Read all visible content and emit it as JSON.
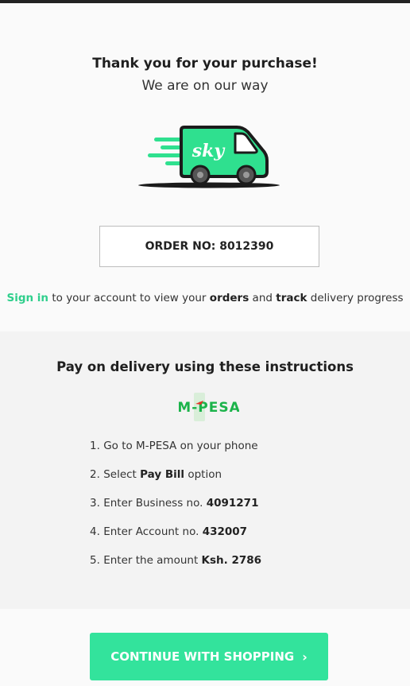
{
  "header": {
    "thank_you": "Thank you for your purchase!",
    "subtitle": "We are on our way"
  },
  "logo": {
    "text": "sky",
    "icon": "delivery-van-icon",
    "brand_color": "#2fe08f"
  },
  "order": {
    "label": "ORDER NO:",
    "number": "8012390"
  },
  "signin_line": {
    "link": "Sign in",
    "part1": "to your account to view your",
    "bold1": "orders",
    "part2": "and",
    "bold2": "track",
    "part3": "delivery progress"
  },
  "payment": {
    "title": "Pay on delivery using these instructions",
    "provider_logo": "M-PESA",
    "steps": [
      {
        "num": "1.",
        "text": "Go to M-PESA on your phone",
        "bold": ""
      },
      {
        "num": "2.",
        "text": "Select",
        "bold": "Pay Bill",
        "after": "option"
      },
      {
        "num": "3.",
        "text": "Enter Business no.",
        "bold": "4091271"
      },
      {
        "num": "4.",
        "text": "Enter Account no.",
        "bold": "432007"
      },
      {
        "num": "5.",
        "text": "Enter the amount",
        "bold": "Ksh. 2786"
      }
    ]
  },
  "cta": {
    "label": "CONTINUE WITH SHOPPING",
    "icon": "chevron-right-icon",
    "color": "#33e39c"
  }
}
